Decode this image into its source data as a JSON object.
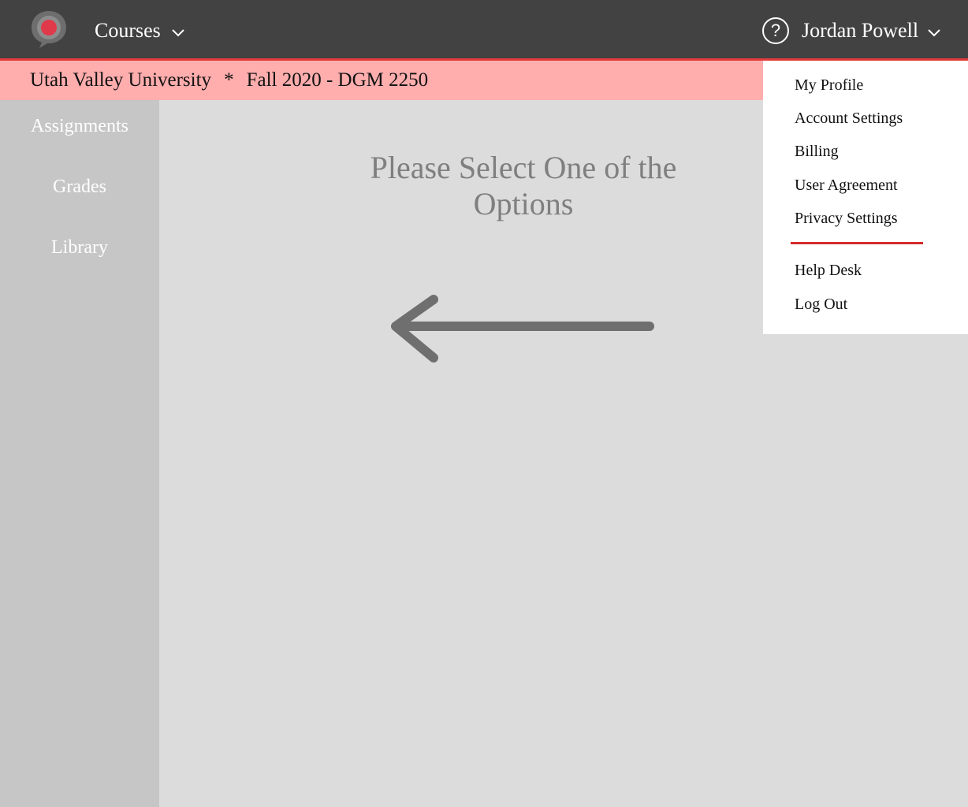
{
  "header": {
    "logo_icon": "speech-bubble-logo-icon",
    "courses_label": "Courses",
    "help_label": "?",
    "user_name": "Jordan Powell"
  },
  "subheader": {
    "university": "Utah Valley University",
    "separator": "*",
    "course": "Fall 2020 - DGM 2250"
  },
  "sidebar": {
    "items": [
      {
        "label": "Assignments"
      },
      {
        "label": "Grades"
      },
      {
        "label": "Library"
      }
    ]
  },
  "main": {
    "prompt_line1": "Please Select One of the",
    "prompt_line2": "Options",
    "arrow_icon": "arrow-left-icon"
  },
  "user_menu": {
    "items": [
      {
        "label": "My Profile"
      },
      {
        "label": "Account Settings"
      },
      {
        "label": "Billing"
      },
      {
        "label": "User Agreement"
      },
      {
        "label": "Privacy Settings"
      }
    ],
    "secondary_items": [
      {
        "label": "Help Desk"
      },
      {
        "label": "Log Out"
      }
    ]
  },
  "colors": {
    "topbar": "#424242",
    "accent_red": "#e23a3a",
    "subbar": "#ffadad",
    "sidebar": "#c6c6c6",
    "content": "#dcdcdc"
  }
}
